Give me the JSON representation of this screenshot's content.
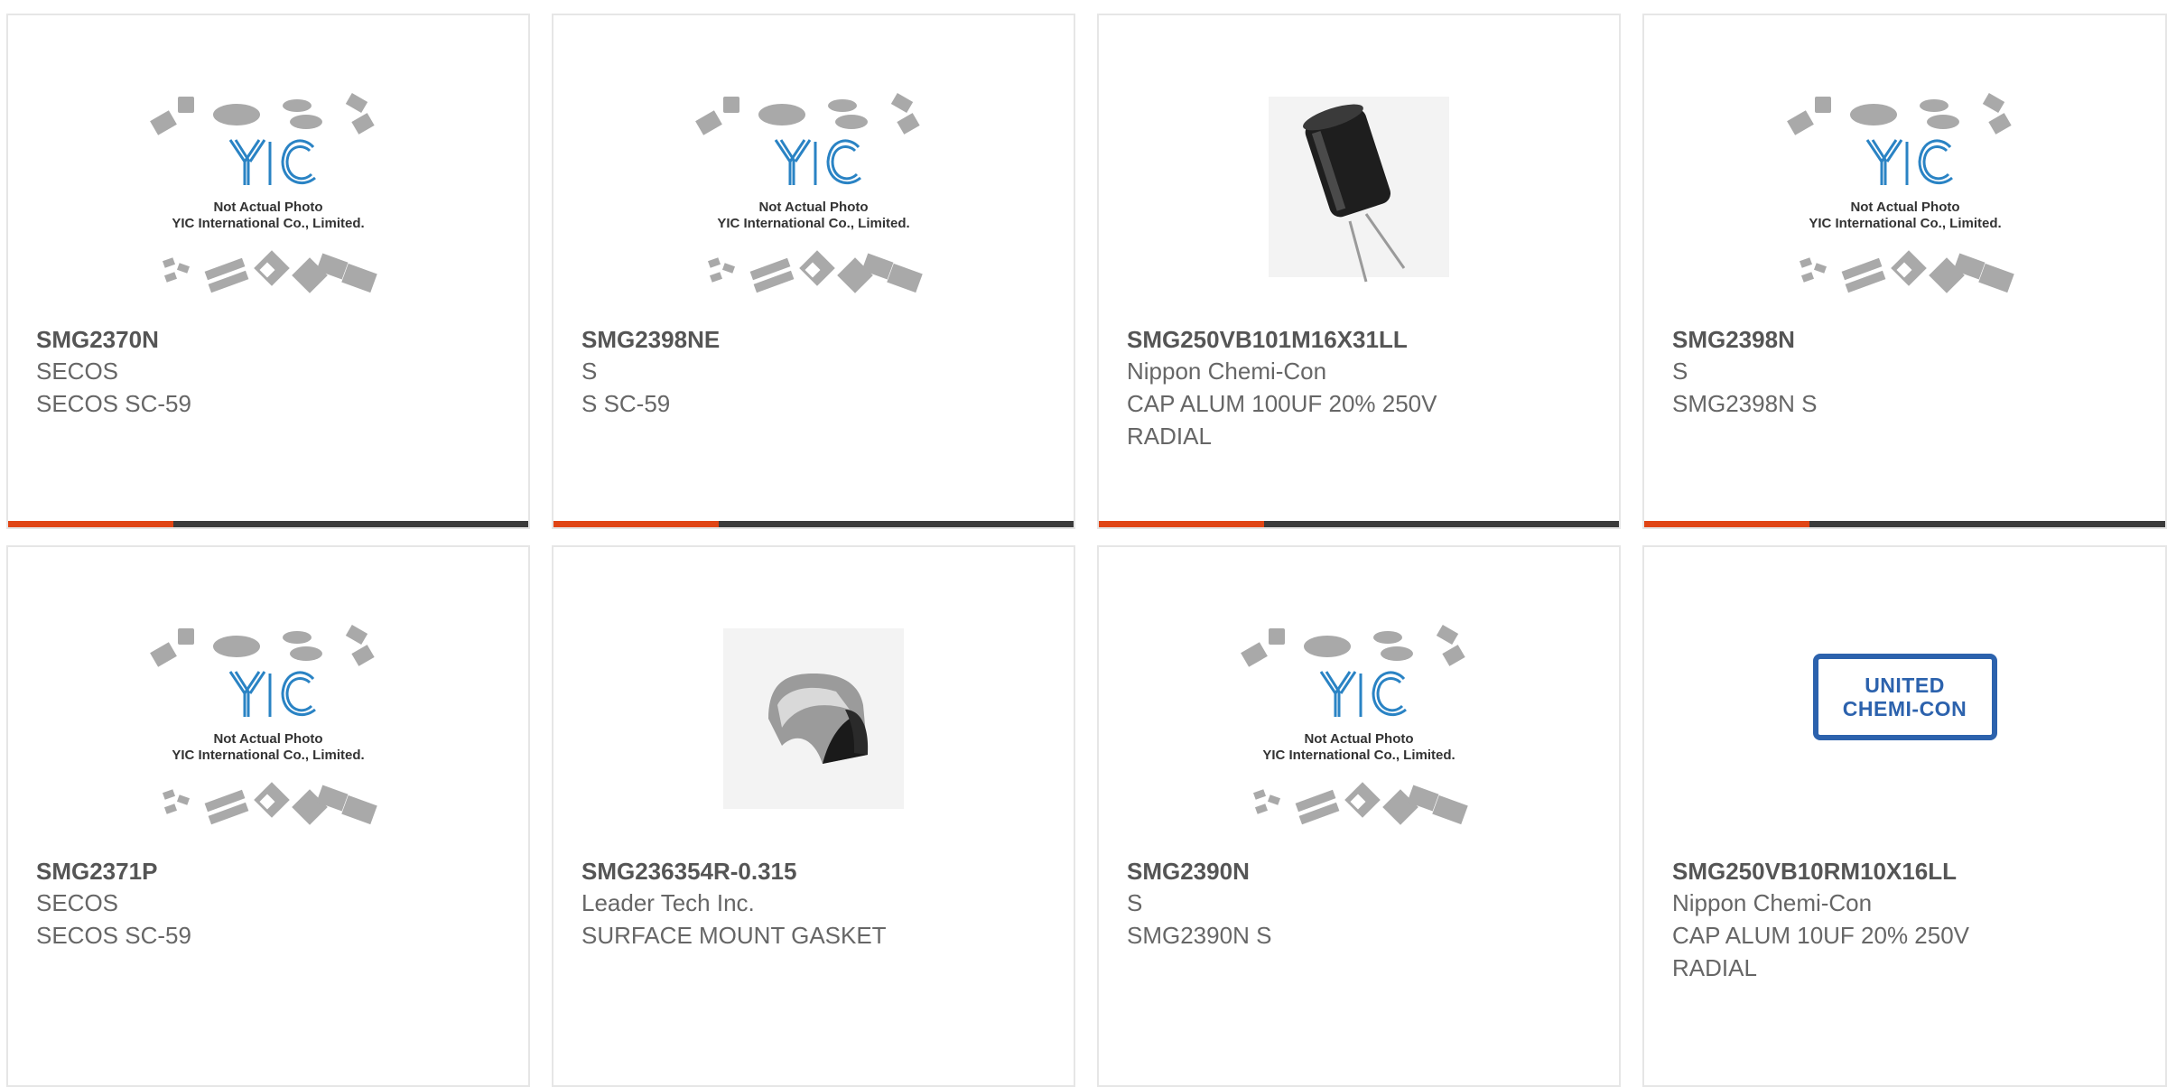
{
  "products": [
    {
      "part": "SMG2370N",
      "manufacturer": "SECOS",
      "description": "SECOS SC-59",
      "image": "yic-placeholder"
    },
    {
      "part": "SMG2398NE",
      "manufacturer": "S",
      "description": "S SC-59",
      "image": "yic-placeholder"
    },
    {
      "part": "SMG250VB101M16X31LL",
      "manufacturer": "Nippon Chemi-Con",
      "description": "CAP ALUM 100UF 20% 250V RADIAL",
      "image": "electrolytic-capacitor-photo"
    },
    {
      "part": "SMG2398N",
      "manufacturer": "S",
      "description": "SMG2398N S",
      "image": "yic-placeholder"
    },
    {
      "part": "SMG2371P",
      "manufacturer": "SECOS",
      "description": "SECOS SC-59",
      "image": "yic-placeholder"
    },
    {
      "part": "SMG236354R-0.315",
      "manufacturer": "Leader Tech Inc.",
      "description": "SURFACE MOUNT GASKET",
      "image": "gasket-photo"
    },
    {
      "part": "SMG2390N",
      "manufacturer": "S",
      "description": "SMG2390N S",
      "image": "yic-placeholder"
    },
    {
      "part": "SMG250VB10RM10X16LL",
      "manufacturer": "Nippon Chemi-Con",
      "description": "CAP ALUM 10UF 20% 250V RADIAL",
      "image": "united-chemi-con-logo"
    }
  ],
  "placeholder": {
    "logo_text": "YIC",
    "line1": "Not Actual Photo",
    "line2": "YIC International Co., Limited."
  },
  "brand_logo": {
    "line1": "UNITED",
    "line2": "CHEMI-CON"
  },
  "colors": {
    "accent": "#e04515",
    "bar": "#3b3b3b",
    "border": "#e6e6e6",
    "yic_blue": "#2a83c4",
    "ucc_blue": "#2c62ad"
  }
}
